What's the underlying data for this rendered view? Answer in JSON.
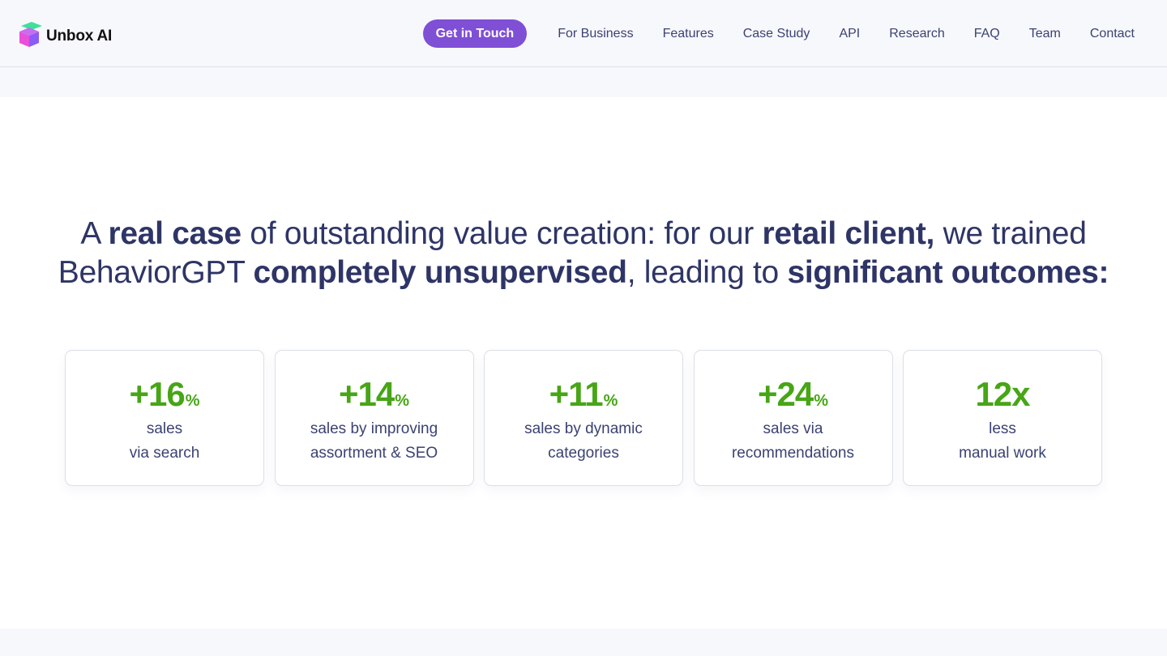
{
  "brand": {
    "name": "Unbox AI",
    "colors": {
      "accent": "#7f4fd6",
      "positive": "#47a516",
      "text": "#2e3566",
      "logo_green": "#3ee09a",
      "logo_pink": "#e94fd8",
      "logo_purple": "#8b5cf6"
    }
  },
  "nav": {
    "cta_label": "Get in Touch",
    "items": [
      "For Business",
      "Features",
      "Case Study",
      "API",
      "Research",
      "FAQ",
      "Team",
      "Contact"
    ]
  },
  "headline": {
    "parts": [
      {
        "text": "A ",
        "bold": false
      },
      {
        "text": "real case",
        "bold": true
      },
      {
        "text": " of outstanding value creation: for our ",
        "bold": false
      },
      {
        "text": "retail client,",
        "bold": true
      },
      {
        "text": " we trained BehaviorGPT ",
        "bold": false
      },
      {
        "text": "completely unsupervised",
        "bold": true
      },
      {
        "text": ", leading to ",
        "bold": false
      },
      {
        "text": "significant outcomes:",
        "bold": true
      }
    ]
  },
  "stats": [
    {
      "value": "+16",
      "unit": "%",
      "line1": "sales",
      "line2": "via search"
    },
    {
      "value": "+14",
      "unit": "%",
      "line1": "sales by improving",
      "line2": "assortment & SEO"
    },
    {
      "value": "+11",
      "unit": "%",
      "line1": "sales by dynamic",
      "line2": "categories"
    },
    {
      "value": "+24",
      "unit": "%",
      "line1": "sales via",
      "line2": "recommendations"
    },
    {
      "value": "12",
      "unit": "x",
      "line1": "less",
      "line2": "manual work"
    }
  ]
}
